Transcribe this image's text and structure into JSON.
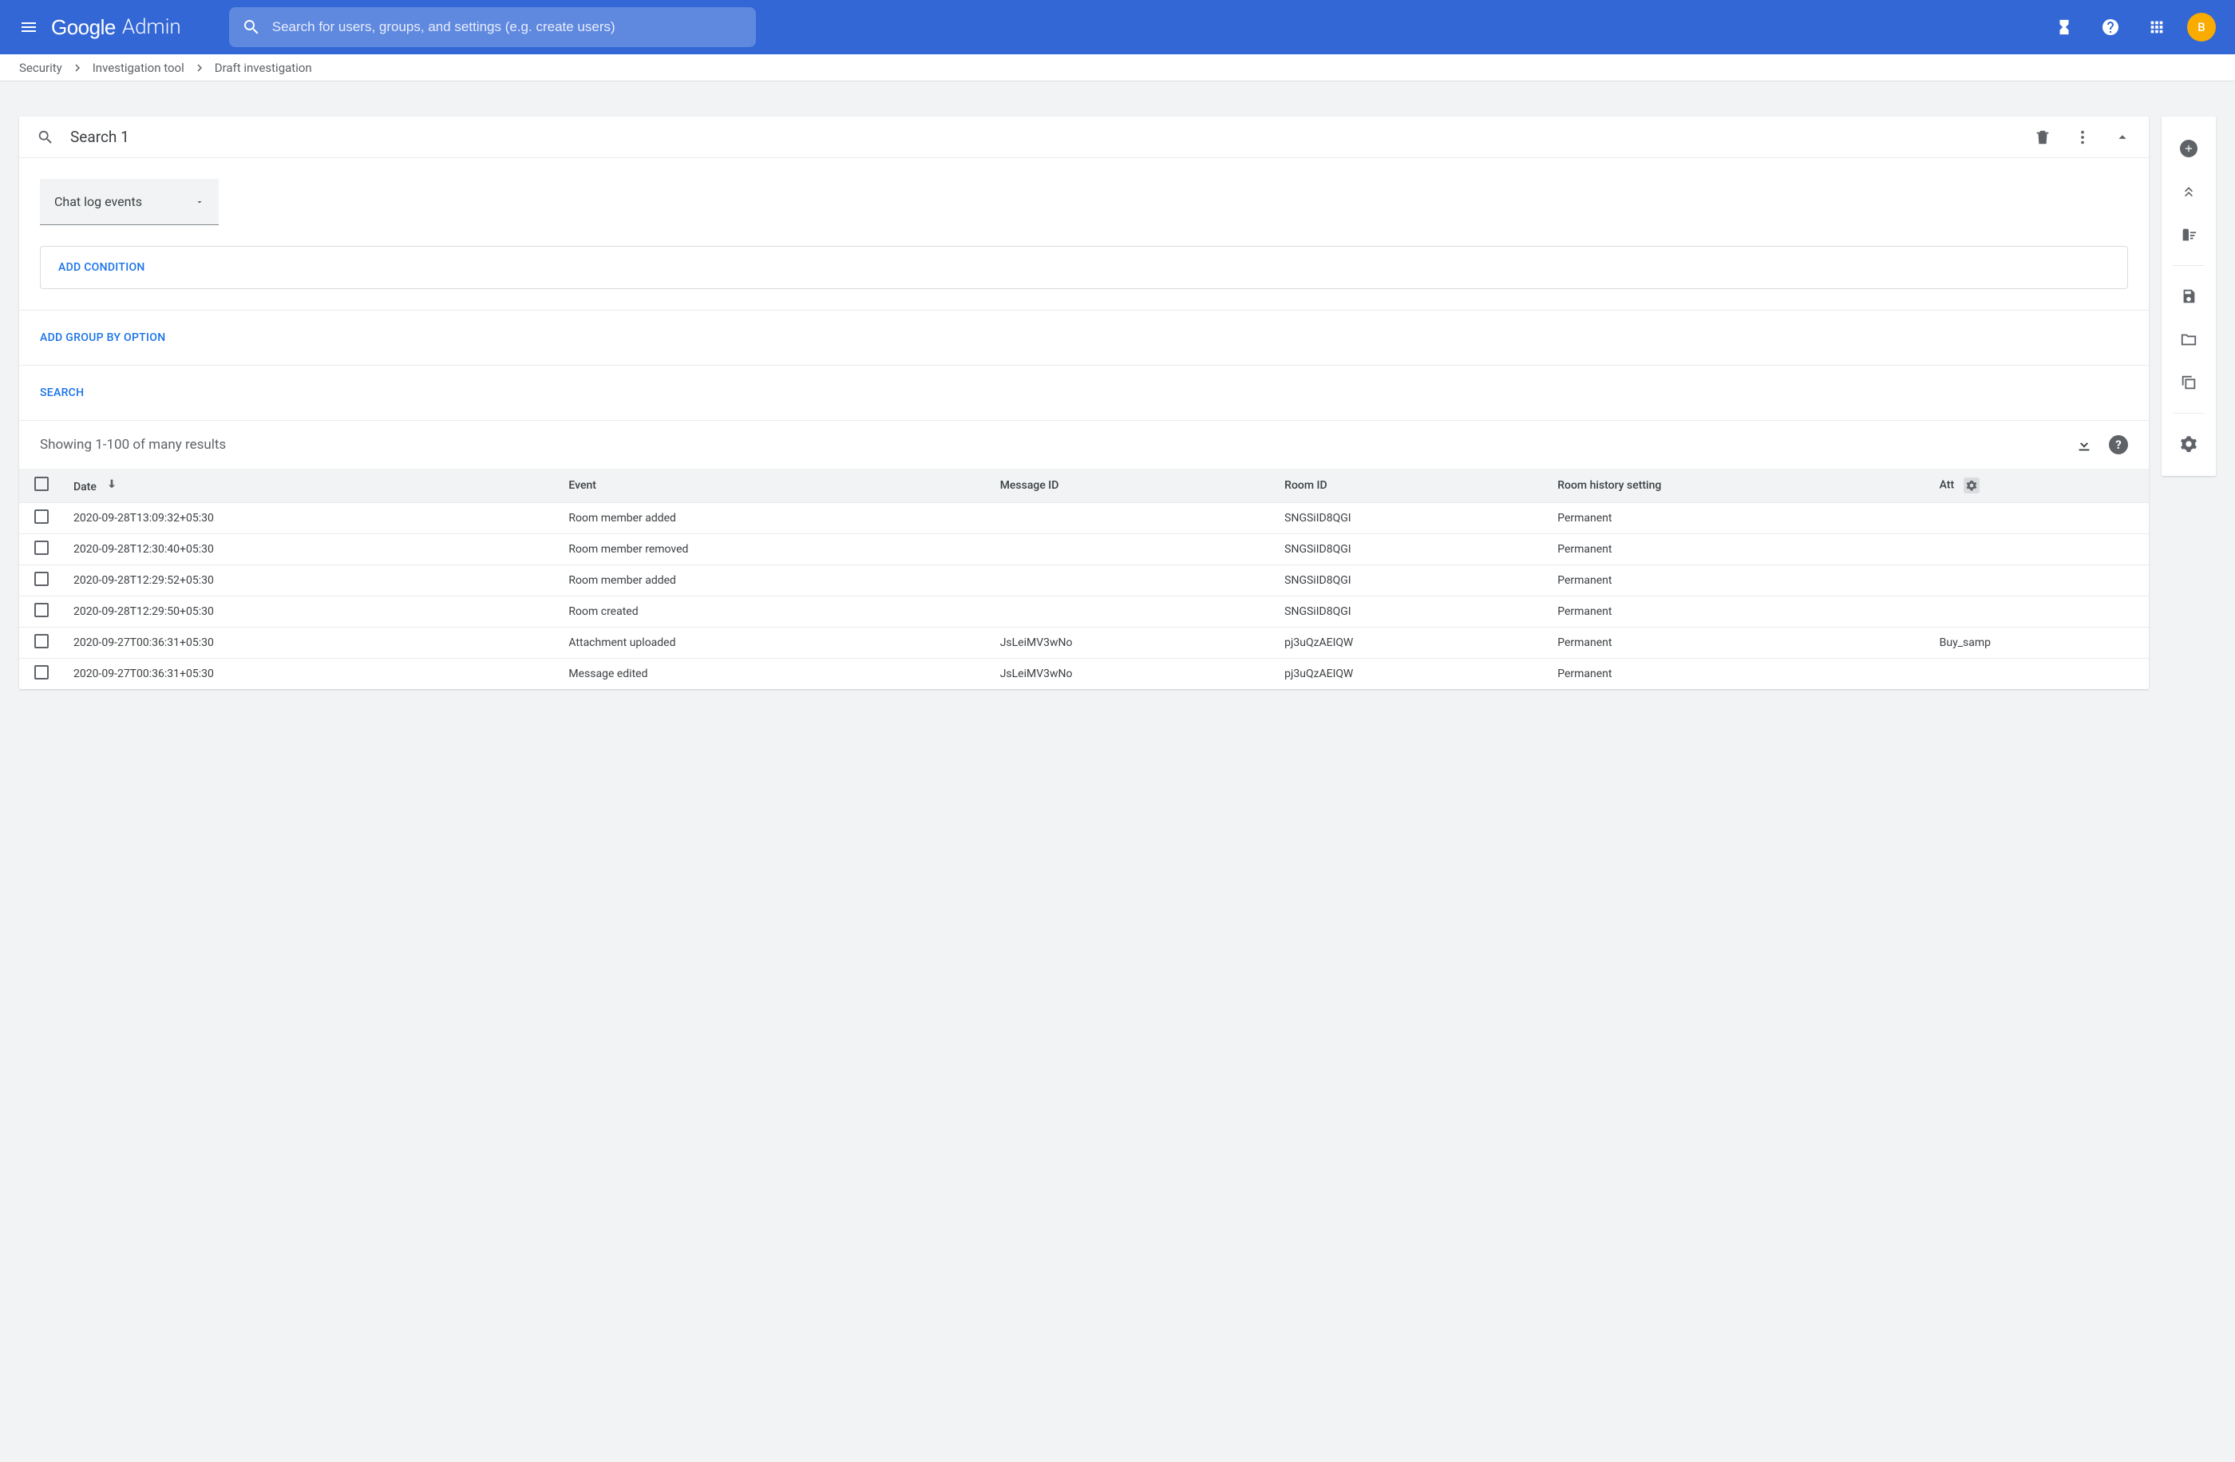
{
  "header": {
    "app_name_1": "Google",
    "app_name_2": "Admin",
    "search_placeholder": "Search for users, groups, and settings (e.g. create users)",
    "avatar_initial": "B"
  },
  "breadcrumb": {
    "items": [
      "Security",
      "Investigation tool",
      "Draft investigation"
    ]
  },
  "search_card": {
    "title": "Search 1",
    "datasource_label": "Chat log events",
    "add_condition_label": "ADD CONDITION",
    "group_by_label": "ADD GROUP BY OPTION",
    "search_button_label": "SEARCH"
  },
  "results": {
    "summary": "Showing 1-100 of many results",
    "columns": [
      "Date",
      "Event",
      "Message ID",
      "Room ID",
      "Room history setting",
      "Att"
    ],
    "rows": [
      {
        "date": "2020-09-28T13:09:32+05:30",
        "event": "Room member added",
        "msg": "",
        "room": "SNGSiID8QGI",
        "hist": "Permanent",
        "att": ""
      },
      {
        "date": "2020-09-28T12:30:40+05:30",
        "event": "Room member removed",
        "msg": "",
        "room": "SNGSiID8QGI",
        "hist": "Permanent",
        "att": ""
      },
      {
        "date": "2020-09-28T12:29:52+05:30",
        "event": "Room member added",
        "msg": "",
        "room": "SNGSiID8QGI",
        "hist": "Permanent",
        "att": ""
      },
      {
        "date": "2020-09-28T12:29:50+05:30",
        "event": "Room created",
        "msg": "",
        "room": "SNGSiID8QGI",
        "hist": "Permanent",
        "att": ""
      },
      {
        "date": "2020-09-27T00:36:31+05:30",
        "event": "Attachment uploaded",
        "msg": "JsLeiMV3wNo",
        "room": "pj3uQzAEIQW",
        "hist": "Permanent",
        "att": "Buy_samp"
      },
      {
        "date": "2020-09-27T00:36:31+05:30",
        "event": "Message edited",
        "msg": "JsLeiMV3wNo",
        "room": "pj3uQzAEIQW",
        "hist": "Permanent",
        "att": ""
      }
    ]
  }
}
